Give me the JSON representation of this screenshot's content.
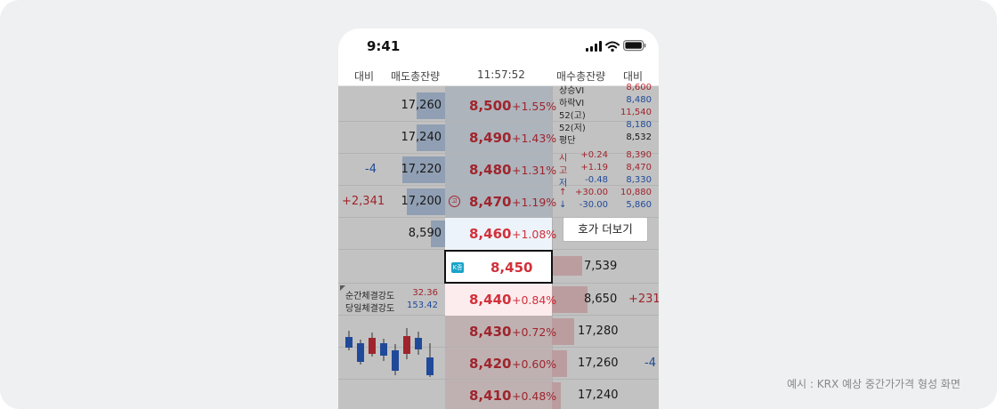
{
  "status": {
    "time": "9:41"
  },
  "header": {
    "change_left": "대비",
    "sell_total": "매도총잔량",
    "time": "11:57:52",
    "buy_total": "매수총잔량",
    "change_right": "대비"
  },
  "ask_rows": [
    {
      "change": "",
      "volume": "17,260",
      "price": "8,500",
      "pct": "+1.55%",
      "marker": ""
    },
    {
      "change": "",
      "volume": "17,240",
      "price": "8,490",
      "pct": "+1.43%",
      "marker": ""
    },
    {
      "change": "-4",
      "volume": "17,220",
      "price": "8,480",
      "pct": "+1.31%",
      "marker": ""
    },
    {
      "change": "+2,341",
      "volume": "17,200",
      "price": "8,470",
      "pct": "+1.19%",
      "marker": "고"
    },
    {
      "change": "",
      "volume": "8,590",
      "price": "8,460",
      "pct": "+1.08%",
      "marker": ""
    }
  ],
  "center": {
    "badge": "K종",
    "price": "8,450",
    "volume": "7,539"
  },
  "bid_rows": [
    {
      "volume": "8,650",
      "change": "+231",
      "price": "8,440",
      "pct": "+0.84%"
    },
    {
      "volume": "17,280",
      "change": "",
      "price": "8,430",
      "pct": "+0.72%"
    },
    {
      "volume": "17,260",
      "change": "-4",
      "price": "8,420",
      "pct": "+0.60%"
    },
    {
      "volume": "17,240",
      "change": "",
      "price": "8,410",
      "pct": "+0.48%"
    }
  ],
  "info": [
    {
      "label": "상승VI",
      "value": "8,600",
      "color": "#d2303a"
    },
    {
      "label": "하락VI",
      "value": "8,480",
      "color": "#2b62c9"
    },
    {
      "label": "52(고)",
      "value": "11,540",
      "color": "#d2303a"
    },
    {
      "label": "52(저)",
      "value": "8,180",
      "color": "#2b62c9"
    },
    {
      "label": "평단",
      "value": "8,532",
      "color": "#222222"
    }
  ],
  "ohlc": [
    {
      "label": "시",
      "change": "+0.24",
      "value": "8,390",
      "color": "#d2303a"
    },
    {
      "label": "고",
      "change": "+1.19",
      "value": "8,470",
      "color": "#d2303a"
    },
    {
      "label": "저",
      "change": "-0.48",
      "value": "8,330",
      "color": "#2b62c9"
    },
    {
      "label": "↑",
      "change": "+30.00",
      "value": "10,880",
      "color": "#d2303a"
    },
    {
      "label": "↓",
      "change": "-30.00",
      "value": "5,860",
      "color": "#2b62c9"
    }
  ],
  "more_button": "호가 더보기",
  "strength": [
    {
      "label": "순간체결강도",
      "value": "32.36",
      "color": "#d2303a"
    },
    {
      "label": "당일체결강도",
      "value": "153.42",
      "color": "#2b62c9"
    }
  ],
  "caption": "예시 : KRX 예상 중간가가격 형성 화면",
  "colors": {
    "up": "#d2303a",
    "down": "#2b62c9",
    "ask_bar": "#bed2ec",
    "bid_bar": "#f6cfd1"
  }
}
